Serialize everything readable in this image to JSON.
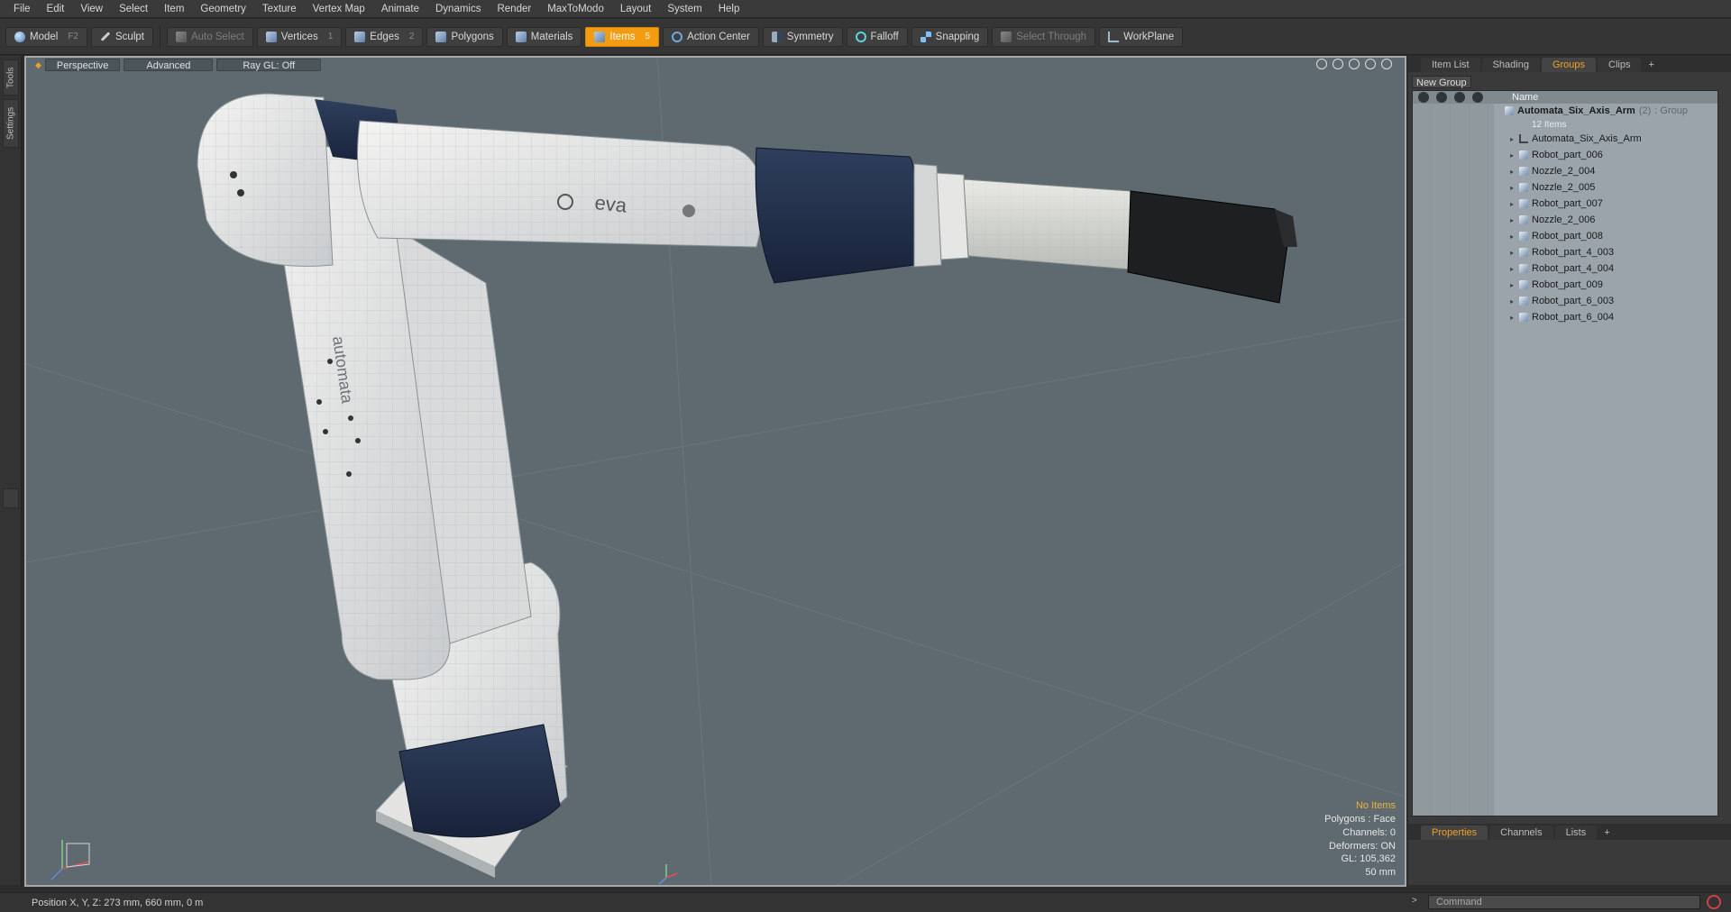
{
  "menu": [
    "File",
    "Edit",
    "View",
    "Select",
    "Item",
    "Geometry",
    "Texture",
    "Vertex Map",
    "Animate",
    "Dynamics",
    "Render",
    "MaxToModo",
    "Layout",
    "System",
    "Help"
  ],
  "toolbar": {
    "model": "Model",
    "model_key": "F2",
    "sculpt": "Sculpt",
    "auto_select": "Auto Select",
    "vertices": "Vertices",
    "vertices_key": "1",
    "edges": "Edges",
    "edges_key": "2",
    "polygons": "Polygons",
    "materials": "Materials",
    "items": "Items",
    "items_key": "5",
    "action_center": "Action Center",
    "symmetry": "Symmetry",
    "falloff": "Falloff",
    "snapping": "Snapping",
    "select_through": "Select Through",
    "workplane": "WorkPlane"
  },
  "left_tabs": [
    "Tools",
    "Settings"
  ],
  "viewport": {
    "view_mode": "Perspective",
    "shading": "Advanced",
    "raygl": "Ray GL: Off",
    "model_text_upper": "eva",
    "model_text_side": "automata",
    "info": {
      "items": "No Items",
      "polygons": "Polygons : Face",
      "channels": "Channels: 0",
      "deformers": "Deformers: ON",
      "gl": "GL: 105,362",
      "scale": "50 mm"
    }
  },
  "right_panel": {
    "tabs": [
      "Item List",
      "Shading",
      "Groups",
      "Clips",
      "+"
    ],
    "active_tab": "Groups",
    "new_group": "New Group",
    "column_name": "Name",
    "group": {
      "name": "Automata_Six_Axis_Arm",
      "count": "(2)",
      "type": ": Group",
      "items_count": "12 Items"
    },
    "items": [
      "Automata_Six_Axis_Arm",
      "Robot_part_006",
      "Nozzle_2_004",
      "Nozzle_2_005",
      "Robot_part_007",
      "Nozzle_2_006",
      "Robot_part_008",
      "Robot_part_4_003",
      "Robot_part_4_004",
      "Robot_part_009",
      "Robot_part_6_003",
      "Robot_part_6_004"
    ],
    "bottom_tabs": [
      "Properties",
      "Channels",
      "Lists",
      "+"
    ]
  },
  "status": {
    "position": "Position X, Y, Z:   273 mm, 660 mm, 0 m",
    "command_placeholder": "Command"
  },
  "colors": {
    "accent": "#f39c12",
    "viewport_bg": "#5e6a70",
    "list_bg": "#9aa4aa"
  }
}
